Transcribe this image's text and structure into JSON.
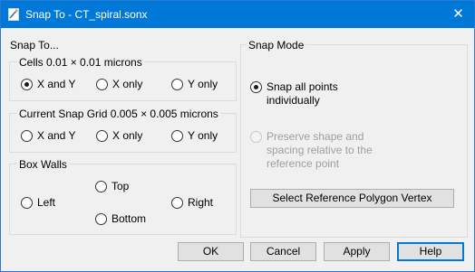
{
  "window": {
    "title": "Snap To - CT_spiral.sonx",
    "close_glyph": "✕",
    "accent": "#0078d7"
  },
  "snap_to": {
    "heading": "Snap To...",
    "cells": {
      "label": "Cells 0.01 × 0.01 microns",
      "options": [
        {
          "label": "X and Y",
          "checked": true
        },
        {
          "label": "X only",
          "checked": false
        },
        {
          "label": "Y only",
          "checked": false
        }
      ]
    },
    "current_grid": {
      "label": "Current Snap Grid 0.005 × 0.005 microns",
      "options": [
        {
          "label": "X and Y",
          "checked": false
        },
        {
          "label": "X only",
          "checked": false
        },
        {
          "label": "Y only",
          "checked": false
        }
      ]
    },
    "box_walls": {
      "label": "Box Walls",
      "left": "Left",
      "top": "Top",
      "right": "Right",
      "bottom": "Bottom"
    }
  },
  "snap_mode": {
    "heading": "Snap Mode",
    "option1": "Snap all points individually",
    "option2": "Preserve shape and spacing relative to the reference point",
    "select_button": "Select Reference Polygon Vertex"
  },
  "buttons": {
    "ok": "OK",
    "cancel": "Cancel",
    "apply": "Apply",
    "help": "Help"
  }
}
